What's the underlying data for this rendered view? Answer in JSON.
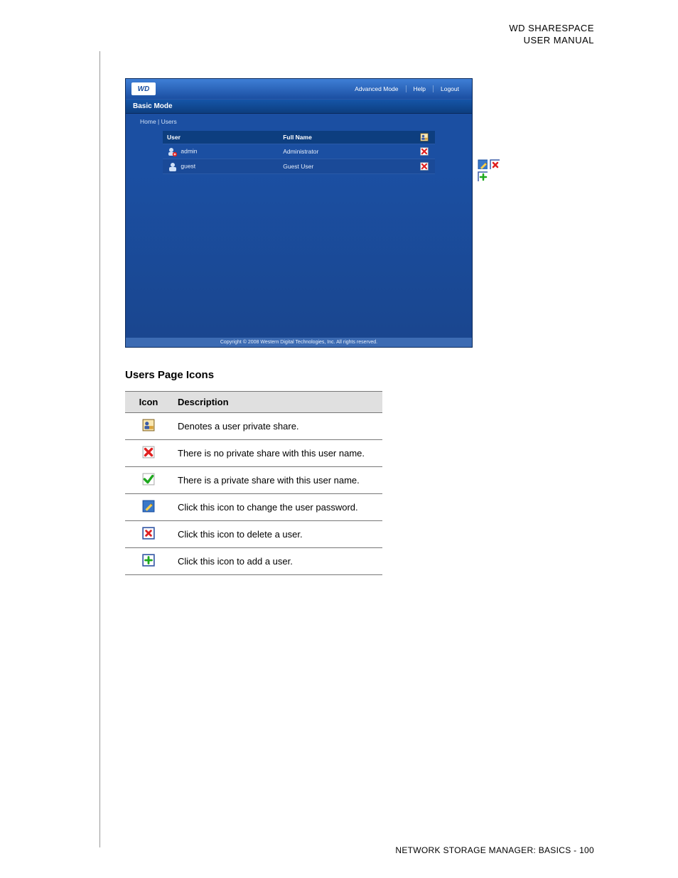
{
  "header": {
    "line1": "WD SHARESPACE",
    "line2": "USER MANUAL"
  },
  "screenshot": {
    "logo_text": "WD",
    "top_links": [
      "Advanced Mode",
      "Help",
      "Logout"
    ],
    "mode_label": "Basic Mode",
    "breadcrumb": "Home  |  Users",
    "columns": {
      "user": "User",
      "full_name": "Full Name"
    },
    "rows": [
      {
        "user": "admin",
        "full_name": "Administrator",
        "status_icon": "no-private"
      },
      {
        "user": "guest",
        "full_name": "Guest User",
        "status_icon": "no-private"
      }
    ],
    "header_status_icon": "private-share",
    "side_icons_row": [
      "edit-password",
      "delete-user"
    ],
    "side_icons_row2": [
      "add-user"
    ],
    "copyright": "Copyright © 2008 Western Digital Technologies, Inc. All rights reserved."
  },
  "section": {
    "title": "Users Page Icons",
    "col_icon": "Icon",
    "col_desc": "Description",
    "rows": [
      {
        "icon": "private-share",
        "desc": "Denotes a user private share."
      },
      {
        "icon": "no-private",
        "desc": "There is no private share with this user name."
      },
      {
        "icon": "has-private",
        "desc": "There is a private share with this user name."
      },
      {
        "icon": "edit-password",
        "desc": "Click this icon to change the user password."
      },
      {
        "icon": "delete-user",
        "desc": "Click this icon to delete a user."
      },
      {
        "icon": "add-user",
        "desc": "Click this icon to add a user."
      }
    ]
  },
  "footer": {
    "text": "NETWORK STORAGE MANAGER: BASICS - 100"
  }
}
